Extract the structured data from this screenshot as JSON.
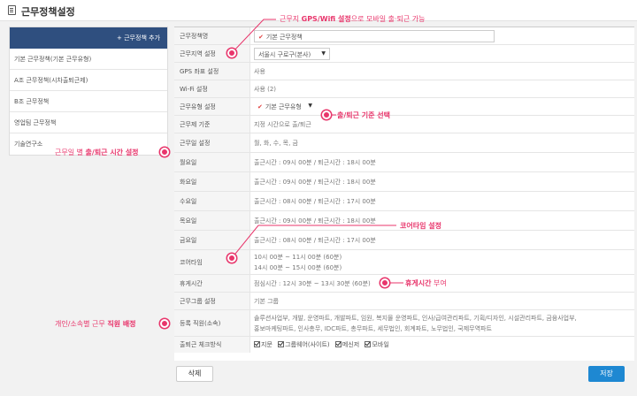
{
  "header": {
    "title": "근무정책설정"
  },
  "sidebar": {
    "add_label": "+ 근무정책 추가",
    "items": [
      "기본 근무정책(기본 근무유형)",
      "A조 근무정책(시차출퇴근제)",
      "B조 근무정책",
      "영업팀 근무정책",
      "기술연구소"
    ]
  },
  "form": {
    "policy_name_label": "근무정책명",
    "policy_name_value": "기본 근무정책",
    "location_label": "근무지역 설정",
    "location_value": "서울시 구로구(본사)",
    "gps_label": "GPS 좌표 설정",
    "gps_value": "사용",
    "wifi_label": "Wi-Fi 설정",
    "wifi_value": "사용 (2)",
    "worktype_label": "근무유형 설정",
    "worktype_value": "기본 근무유형",
    "basis_label": "근무제 기준",
    "basis_value": "지정 시간으로 출/퇴근",
    "workdays_label": "근무일 설정",
    "workdays_value": "월, 화, 수, 목, 금",
    "mon_label": "월요일",
    "mon_value": "출근시간 : 09시 00분 / 퇴근시간 : 18시 00분",
    "tue_label": "화요일",
    "tue_value": "출근시간 : 09시 00분 / 퇴근시간 : 18시 00분",
    "wed_label": "수요일",
    "wed_value": "출근시간 : 08시 00분 / 퇴근시간 : 17시 00분",
    "thu_label": "목요일",
    "thu_value": "출근시간 : 09시 00분 / 퇴근시간 : 18시 00분",
    "fri_label": "금요일",
    "fri_value": "출근시간 : 08시 00분 / 퇴근시간 : 17시 00분",
    "core_label": "코어타임",
    "core_line1": "10시 00분 ~ 11시 00분 (60분)",
    "core_line2": "14시 00분 ~ 15시 00분 (60분)",
    "break_label": "휴게시간",
    "break_value": "점심시간 : 12시 30분 ~ 13시 30분 (60분)",
    "group_label": "근무그룹 설정",
    "group_value": "기본 그룹",
    "members_label": "등록 직원(소속)",
    "members_line1": "솔루션사업부, 개발, 운영파트, 개발파트, 임원, 복지몰 운영파트, 인사/급여관리파트, 기획/디자인, 시설관리파트, 금융사업부,",
    "members_line2": "홍보마케팅파트, 인사총무, IDC파트, 총무파트, 세무법인, 회계파트, 노무법인, 국제무역파트",
    "checkin_label": "출퇴근 체크방식",
    "checkin_options": [
      "지문",
      "그룹웨어(사이트)",
      "메신저",
      "모바일"
    ]
  },
  "buttons": {
    "delete": "삭제",
    "save": "저장"
  },
  "callouts": {
    "gps_pre": "근무지 ",
    "gps_bold": "GPS/Wifi 설정",
    "gps_post": "으로 모바일 출·퇴근 가능",
    "checkin_basis": "출/퇴근 기준 선택",
    "workday_pre": "근무일 별 ",
    "workday_bold": "출/퇴근 시간 설정",
    "core": "코어타임 설정",
    "break_bold": "휴게시간",
    "break_post": " 부여",
    "staff_pre": "개인/소속별 근무 ",
    "staff_bold": "직원 배정"
  },
  "colors": {
    "accent": "#e8356b",
    "primary": "#1e88d2",
    "sidebar_head": "#2f4f7f"
  }
}
